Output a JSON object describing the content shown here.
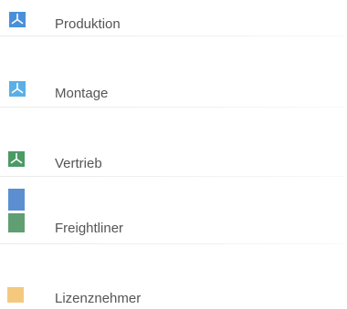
{
  "legend": {
    "items": [
      {
        "label": "Produktion",
        "color": "#4a90d9",
        "icon": "mercedes-star-icon"
      },
      {
        "label": "Montage",
        "color": "#5ab0e6",
        "icon": "mercedes-star-icon"
      },
      {
        "label": "Vertrieb",
        "color": "#4c9a66",
        "icon": "mercedes-star-icon"
      },
      {
        "label": "Freightliner",
        "color_top": "#5b8fd1",
        "color_bottom": "#5f9f72"
      },
      {
        "label": "Lizenznehmer",
        "color": "#f4c97e"
      }
    ]
  }
}
